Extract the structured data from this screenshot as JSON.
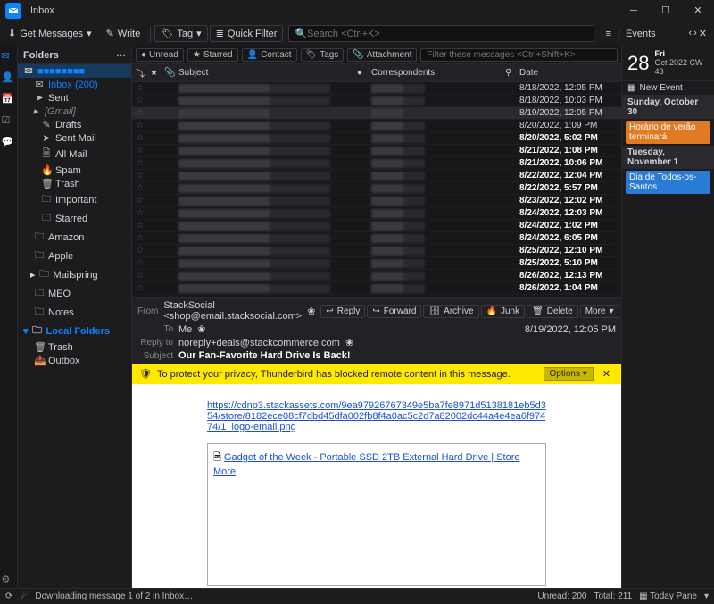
{
  "window": {
    "title": "Inbox"
  },
  "toolbar": {
    "get_messages": "Get Messages",
    "write": "Write",
    "tag": "Tag",
    "quick_filter": "Quick Filter",
    "search_placeholder": "Search <Ctrl+K>"
  },
  "events_panel": {
    "header": "Events",
    "day": "28",
    "weekday": "Fri",
    "month_line": "Oct 2022  CW 43",
    "new_event": "New Event",
    "sections": [
      {
        "title": "Sunday, October 30",
        "events": [
          {
            "label": "Horário de verão terminará",
            "color": "orange"
          }
        ]
      },
      {
        "title": "Tuesday, November 1",
        "events": [
          {
            "label": "Dia de Todos-os-Santos",
            "color": "blue"
          }
        ]
      }
    ]
  },
  "sidebar": {
    "header": "Folders",
    "account_redacted": "■■■■■■■■",
    "items": [
      {
        "label": "Inbox (200)",
        "icon": "✉",
        "sel": true,
        "indent": 18
      },
      {
        "label": "Sent",
        "icon": "➤",
        "indent": 18
      },
      {
        "label": "[Gmail]",
        "icon": "▸",
        "gmail": true,
        "indent": 14
      },
      {
        "label": "Drafts",
        "icon": "✎",
        "indent": 26
      },
      {
        "label": "Sent Mail",
        "icon": "➤",
        "indent": 26
      },
      {
        "label": "All Mail",
        "icon": "🗎",
        "indent": 26
      },
      {
        "label": "Spam",
        "icon": "🔥",
        "indent": 26
      },
      {
        "label": "Trash",
        "icon": "🗑",
        "indent": 26
      },
      {
        "label": "Important",
        "icon": "🗀",
        "indent": 26
      },
      {
        "label": "Starred",
        "icon": "🗀",
        "indent": 26
      },
      {
        "label": "Amazon",
        "icon": "🗀",
        "indent": 18
      },
      {
        "label": "Apple",
        "icon": "🗀",
        "indent": 18
      },
      {
        "label": "Mailspring",
        "icon": "🗀",
        "indent": 14,
        "exp": "▸"
      },
      {
        "label": "MEO",
        "icon": "🗀",
        "indent": 18
      },
      {
        "label": "Notes",
        "icon": "🗀",
        "indent": 18
      }
    ],
    "local_header": "Local Folders",
    "local": [
      {
        "label": "Trash",
        "icon": "🗑",
        "indent": 18
      },
      {
        "label": "Outbox",
        "icon": "📤",
        "indent": 18
      }
    ]
  },
  "filter": {
    "unread": "Unread",
    "starred": "Starred",
    "contact": "Contact",
    "tags": "Tags",
    "attachment": "Attachment",
    "placeholder": "Filter these messages <Ctrl+Shift+K>"
  },
  "cols": {
    "subject": "Subject",
    "correspondents": "Correspondents",
    "date": "Date"
  },
  "messages": [
    {
      "date": "8/18/2022, 12:05 PM",
      "bold": false
    },
    {
      "date": "8/18/2022, 10:03 PM",
      "bold": false
    },
    {
      "date": "8/19/2022, 12:05 PM",
      "sel": true,
      "bold": false
    },
    {
      "date": "8/20/2022, 1:09 PM",
      "bold": false
    },
    {
      "date": "8/20/2022, 5:02 PM",
      "bold": true,
      "dot": true
    },
    {
      "date": "8/21/2022, 1:08 PM",
      "bold": true,
      "dot": true
    },
    {
      "date": "8/21/2022, 10:06 PM",
      "bold": true,
      "dot": true
    },
    {
      "date": "8/22/2022, 12:04 PM",
      "bold": true,
      "dot": true
    },
    {
      "date": "8/22/2022, 5:57 PM",
      "bold": true,
      "dot": true
    },
    {
      "date": "8/23/2022, 12:02 PM",
      "bold": true,
      "dot": true
    },
    {
      "date": "8/24/2022, 12:03 PM",
      "bold": true,
      "dot": true
    },
    {
      "date": "8/24/2022, 1:02 PM",
      "bold": true,
      "dot": true
    },
    {
      "date": "8/24/2022, 6:05 PM",
      "bold": true,
      "dot": true
    },
    {
      "date": "8/25/2022, 12:10 PM",
      "bold": true,
      "dot": true
    },
    {
      "date": "8/25/2022, 5:10 PM",
      "bold": true,
      "dot": true
    },
    {
      "date": "8/26/2022, 12:13 PM",
      "bold": true,
      "dot": true
    },
    {
      "date": "8/26/2022, 1:04 PM",
      "bold": true,
      "dot": true
    }
  ],
  "reader": {
    "from_label": "From",
    "from": "StackSocial <shop@email.stacksocial.com>",
    "to_label": "To",
    "to": "Me",
    "reply_to_label": "Reply to",
    "reply_to": "noreply+deals@stackcommerce.com",
    "subject_label": "Subject",
    "subject": "Our Fan-Favorite Hard Drive Is Back!",
    "date": "8/19/2022, 12:05 PM",
    "actions": {
      "reply": "Reply",
      "forward": "Forward",
      "archive": "Archive",
      "junk": "Junk",
      "delete": "Delete",
      "more": "More"
    },
    "privacy": "To protect your privacy, Thunderbird has blocked remote content in this message.",
    "options": "Options",
    "body_link": "https://cdnp3.stackassets.com/9ea97926767349e5ba7fe8971d5138181eb5d354/store/8182ece08cf7dbd45dfa002fb8f4a0ac5c2d7a82002dc44a4e4ea6f97474/1_logo-email.png",
    "gadget": "Gadget of the Week - Portable SSD 2TB External Hard Drive | Store More"
  },
  "status": {
    "downloading": "Downloading message 1 of 2 in Inbox…",
    "unread": "Unread: 200",
    "total": "Total: 211",
    "today_pane": "Today Pane"
  }
}
